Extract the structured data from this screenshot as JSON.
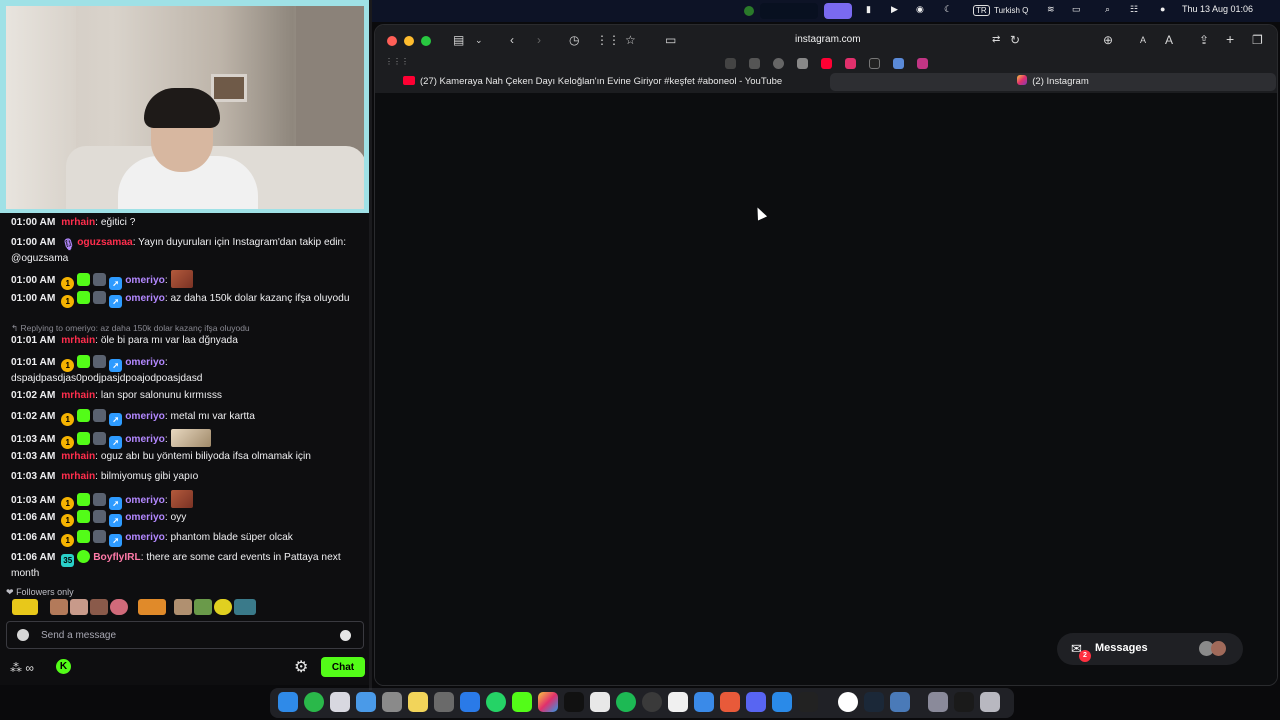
{
  "menubar": {
    "input_source": "TR",
    "keyboard": "Turkish Q",
    "datetime": "Thu 13 Aug  01:06"
  },
  "browser": {
    "address": "instagram.com",
    "tabs": [
      {
        "label": "(27) Kameraya Nah Çeken Dayı Keloğlan'ın Evine Giriyor #keşfet #aboneol - YouTube",
        "icon": "youtube-icon"
      },
      {
        "label": "(2) Instagram",
        "icon": "instagram-icon",
        "active": true
      }
    ],
    "reader_small": "A",
    "reader_large": "A",
    "messages": {
      "label": "Messages",
      "count": "2"
    }
  },
  "chat": {
    "messages": [
      {
        "time": "01:00 AM",
        "user": "mrhain",
        "text": "eğitici ?"
      },
      {
        "time": "01:00 AM",
        "user": "oguzsamaa",
        "text": "Yayın duyuruları için Instagram'dan takip edin: @oguzsama"
      },
      {
        "time": "01:00 AM",
        "user": "omeriyo",
        "text": ""
      },
      {
        "time": "01:00 AM",
        "user": "omeriyo",
        "text": "az daha 150k dolar kazanç ifşa oluyodu"
      },
      {
        "time": "01:01 AM",
        "user": "mrhain",
        "text": "öle bi para mı var laa dğnyada",
        "reply": "Replying to omeriyo: az daha 150k dolar kazanç ifşa oluyodu"
      },
      {
        "time": "01:01 AM",
        "user": "omeriyo",
        "text": "dspajdpasdjas0podjpasjdpoajodpoasjdasd"
      },
      {
        "time": "01:02 AM",
        "user": "mrhain",
        "text": "lan spor salonunu kırmısss"
      },
      {
        "time": "01:02 AM",
        "user": "omeriyo",
        "text": "metal mı var kartta"
      },
      {
        "time": "01:03 AM",
        "user": "omeriyo",
        "text": ""
      },
      {
        "time": "01:03 AM",
        "user": "mrhain",
        "text": "oguz abı bu yöntemi biliyoda ifsa olmamak için"
      },
      {
        "time": "01:03 AM",
        "user": "mrhain",
        "text": "bilmiyomuş gibi yapıo"
      },
      {
        "time": "01:03 AM",
        "user": "omeriyo",
        "text": ""
      },
      {
        "time": "01:06 AM",
        "user": "omeriyo",
        "text": "oyy"
      },
      {
        "time": "01:06 AM",
        "user": "omeriyo",
        "text": "phantom blade süper olcak"
      },
      {
        "time": "01:06 AM",
        "user": "BoyflyIRL",
        "badge": "35",
        "text": "there are some card events in Pattaya next month"
      }
    ],
    "followers_only": "Followers only",
    "placeholder": "Send a message",
    "chat_button": "Chat"
  },
  "colors": {
    "kick_green": "#53fc18",
    "red_user": "#ff2e4d",
    "purple_user": "#b388ff",
    "pink_user": "#ff7aa8",
    "webcam_border": "#9fe1e6"
  }
}
